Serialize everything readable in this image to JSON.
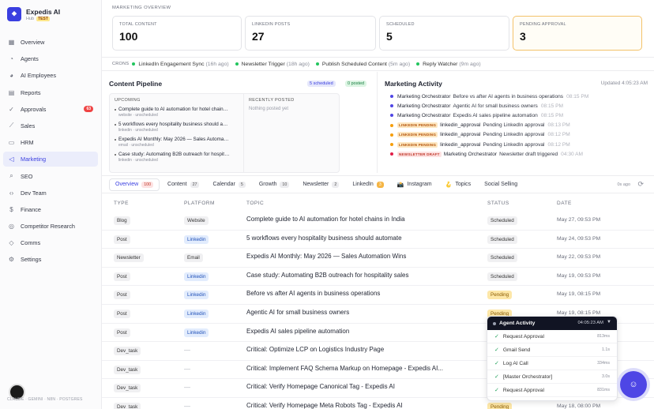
{
  "brand": {
    "name": "Expedis AI",
    "sub": "Hub",
    "badge": "TEST"
  },
  "sidebar": {
    "items": [
      {
        "label": "Overview",
        "icon": "grid-icon"
      },
      {
        "label": "Agents",
        "icon": "user-icon"
      },
      {
        "label": "AI Employees",
        "icon": "users-icon"
      },
      {
        "label": "Reports",
        "icon": "document-icon"
      },
      {
        "label": "Approvals",
        "icon": "check-circle-icon",
        "badge": "63"
      },
      {
        "label": "Sales",
        "icon": "chart-icon"
      },
      {
        "label": "HRM",
        "icon": "briefcase-icon"
      },
      {
        "label": "Marketing",
        "icon": "megaphone-icon",
        "active": true
      },
      {
        "label": "SEO",
        "icon": "search-icon"
      },
      {
        "label": "Dev Team",
        "icon": "code-icon"
      },
      {
        "label": "Finance",
        "icon": "finance-icon"
      },
      {
        "label": "Competitor Research",
        "icon": "target-icon"
      },
      {
        "label": "Comms",
        "icon": "message-icon"
      },
      {
        "label": "Settings",
        "icon": "gear-icon"
      }
    ],
    "footer": "CLAUDE · GEMINI · N8N · POSTGRES"
  },
  "overview": {
    "title": "MARKETING OVERVIEW",
    "stats": [
      {
        "label": "TOTAL CONTENT",
        "value": "100"
      },
      {
        "label": "LINKEDIN POSTS",
        "value": "27"
      },
      {
        "label": "SCHEDULED",
        "value": "5"
      },
      {
        "label": "PENDING APPROVAL",
        "value": "3"
      }
    ]
  },
  "crons": {
    "label": "CRONS",
    "items": [
      {
        "name": "LinkedIn Engagement Sync",
        "ago": "(16h ago)"
      },
      {
        "name": "Newsletter Trigger",
        "ago": "(18h ago)"
      },
      {
        "name": "Publish Scheduled Content",
        "ago": "(5m ago)"
      },
      {
        "name": "Reply Watcher",
        "ago": "(9m ago)"
      }
    ]
  },
  "pipeline": {
    "title": "Content Pipeline",
    "scheduled_chip": "5 scheduled",
    "posted_chip": "0 posted",
    "upcoming_label": "UPCOMING",
    "upcoming": [
      {
        "title": "Complete guide to AI automation for hotel chains in India",
        "meta": "website · unscheduled"
      },
      {
        "title": "5 workflows every hospitality business should automate",
        "meta": "linkedin · unscheduled"
      },
      {
        "title": "Expedis AI Monthly: May 2026 — Sales Automation Wins",
        "meta": "email · unscheduled"
      },
      {
        "title": "Case study: Automating B2B outreach for hospitality sales",
        "meta": "linkedin · unscheduled"
      }
    ],
    "recent_label": "RECENTLY POSTED",
    "recent_empty": "Nothing posted yet"
  },
  "activity": {
    "title": "Marketing Activity",
    "updated": "Updated 4:05:23 AM",
    "rows": [
      {
        "dot": "#4f46e5",
        "tag": "",
        "who": "Marketing Orchestrator",
        "text": "Before vs after AI agents in business operations",
        "time": "08:15 PM"
      },
      {
        "dot": "#4f46e5",
        "tag": "",
        "who": "Marketing Orchestrator",
        "text": "Agentic AI for small business owners",
        "time": "08:15 PM"
      },
      {
        "dot": "#4f46e5",
        "tag": "",
        "who": "Marketing Orchestrator",
        "text": "Expedis AI sales pipeline automation",
        "time": "08:15 PM"
      },
      {
        "dot": "#f59e0b",
        "tag": "LINKEDIN PENDING",
        "who": "linkedin_approval",
        "text": "Pending LinkedIn approval",
        "time": "08:13 PM"
      },
      {
        "dot": "#f59e0b",
        "tag": "LINKEDIN PENDING",
        "who": "linkedin_approval",
        "text": "Pending LinkedIn approval",
        "time": "08:12 PM"
      },
      {
        "dot": "#f59e0b",
        "tag": "LINKEDIN PENDING",
        "who": "linkedin_approval",
        "text": "Pending LinkedIn approval",
        "time": "08:12 PM"
      },
      {
        "dot": "#e11d48",
        "tag": "NEWSLETTER DRAFT",
        "who": "Marketing Orchestrator",
        "text": "Newsletter draft triggered",
        "time": "04:30 AM"
      }
    ]
  },
  "tabs": {
    "items": [
      {
        "label": "Overview",
        "count": "100",
        "active": true
      },
      {
        "label": "Content",
        "count": "27"
      },
      {
        "label": "Calendar",
        "count": "5"
      },
      {
        "label": "Growth",
        "count": "10"
      },
      {
        "label": "Newsletter",
        "count": "2"
      },
      {
        "label": "LinkedIn",
        "count": "3",
        "warn": true
      },
      {
        "label": "Instagram",
        "count": "",
        "icon": "📸"
      },
      {
        "label": "Topics",
        "count": "",
        "icon": "🪝"
      },
      {
        "label": "Social Selling",
        "count": ""
      }
    ],
    "ago": "0s ago"
  },
  "table": {
    "headers": [
      "TYPE",
      "PLATFORM",
      "TOPIC",
      "STATUS",
      "DATE"
    ],
    "rows": [
      {
        "type": "Blog",
        "platform": "Website",
        "li": false,
        "topic": "Complete guide to AI automation for hotel chains in India",
        "status": "Scheduled",
        "pending": false,
        "date": "May 27, 09:53 PM"
      },
      {
        "type": "Post",
        "platform": "Linkedin",
        "li": true,
        "topic": "5 workflows every hospitality business should automate",
        "status": "Scheduled",
        "pending": false,
        "date": "May 24, 09:53 PM"
      },
      {
        "type": "Newsletter",
        "platform": "Email",
        "li": false,
        "topic": "Expedis AI Monthly: May 2026 — Sales Automation Wins",
        "status": "Scheduled",
        "pending": false,
        "date": "May 22, 09:53 PM"
      },
      {
        "type": "Post",
        "platform": "Linkedin",
        "li": true,
        "topic": "Case study: Automating B2B outreach for hospitality sales",
        "status": "Scheduled",
        "pending": false,
        "date": "May 19, 09:53 PM"
      },
      {
        "type": "Post",
        "platform": "Linkedin",
        "li": true,
        "topic": "Before vs after AI agents in business operations",
        "status": "Pending",
        "pending": true,
        "date": "May 19, 08:15 PM"
      },
      {
        "type": "Post",
        "platform": "Linkedin",
        "li": true,
        "topic": "Agentic AI for small business owners",
        "status": "Pending",
        "pending": true,
        "date": "May 19, 08:15 PM"
      },
      {
        "type": "Post",
        "platform": "Linkedin",
        "li": true,
        "topic": "Expedis AI sales pipeline automation",
        "status": "",
        "pending": false,
        "date": ""
      },
      {
        "type": "Dev_task",
        "platform": "—",
        "li": false,
        "dash": true,
        "topic": "Critical: Optimize LCP on Logistics Industry Page",
        "status": "",
        "pending": false,
        "date": ""
      },
      {
        "type": "Dev_task",
        "platform": "—",
        "li": false,
        "dash": true,
        "topic": "Critical: Implement FAQ Schema Markup on Homepage - Expedis AI...",
        "status": "",
        "pending": false,
        "date": ""
      },
      {
        "type": "Dev_task",
        "platform": "—",
        "li": false,
        "dash": true,
        "topic": "Critical: Verify Homepage Canonical Tag - Expedis AI",
        "status": "",
        "pending": false,
        "date": ""
      },
      {
        "type": "Dev_task",
        "platform": "—",
        "li": false,
        "dash": true,
        "topic": "Critical: Verify Homepage Meta Robots Tag - Expedis AI",
        "status": "Pending",
        "pending": true,
        "date": "May 18, 08:00 PM"
      }
    ]
  },
  "agent_activity": {
    "title": "Agent Activity",
    "time": "04:05:23 AM",
    "rows": [
      {
        "label": "Request Approval",
        "dur": "813ms"
      },
      {
        "label": "Gmail Send",
        "dur": "1.1s"
      },
      {
        "label": "Log AI Call",
        "dur": "334ms"
      },
      {
        "label": "[Master Orchestrator]",
        "dur": "3.0s"
      },
      {
        "label": "Request Approval",
        "dur": "831ms"
      }
    ]
  },
  "colors": {
    "accent": "#3a3fe0",
    "pending": "#fde7a8",
    "linkedin": "#e2ecfd"
  }
}
